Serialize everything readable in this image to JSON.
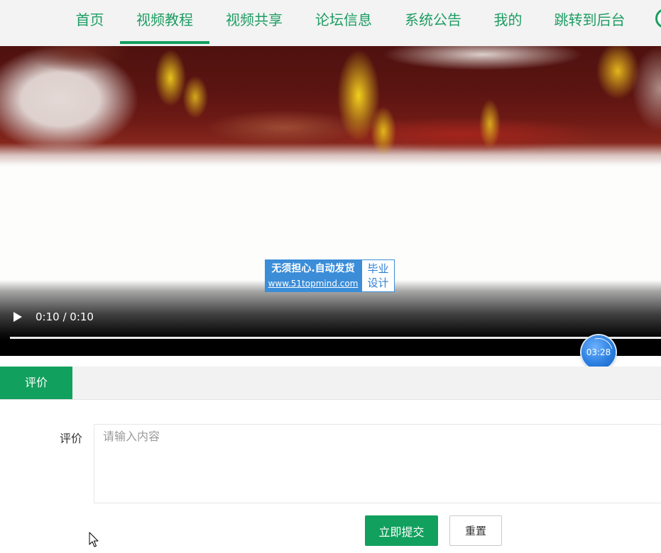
{
  "nav": {
    "items": [
      {
        "label": "首页"
      },
      {
        "label": "视频教程",
        "active": true
      },
      {
        "label": "视频共享"
      },
      {
        "label": "论坛信息"
      },
      {
        "label": "系统公告"
      },
      {
        "label": "我的"
      },
      {
        "label": "跳转到后台"
      }
    ],
    "avatar_icon": "user-avatar-icon"
  },
  "video": {
    "play_icon": "play-icon",
    "time_display": "0:10 / 0:10",
    "progress": 1
  },
  "watermark": {
    "slogan": "无须担心.自动发货",
    "url": "www.51topmind.com",
    "badge": [
      "毕业",
      "设计"
    ]
  },
  "recorder_timer": "03:28",
  "tabs": [
    {
      "label": "评价",
      "active": true
    }
  ],
  "form": {
    "label": "评价",
    "placeholder": "请输入内容",
    "value": ""
  },
  "actions": {
    "submit": "立即提交",
    "reset": "重置"
  },
  "theme": {
    "accent": "#12a05e",
    "nav_text": "#1d9d62",
    "nav_bg": "#f3f3f3",
    "watermark_blue": "#3b8dd8"
  }
}
